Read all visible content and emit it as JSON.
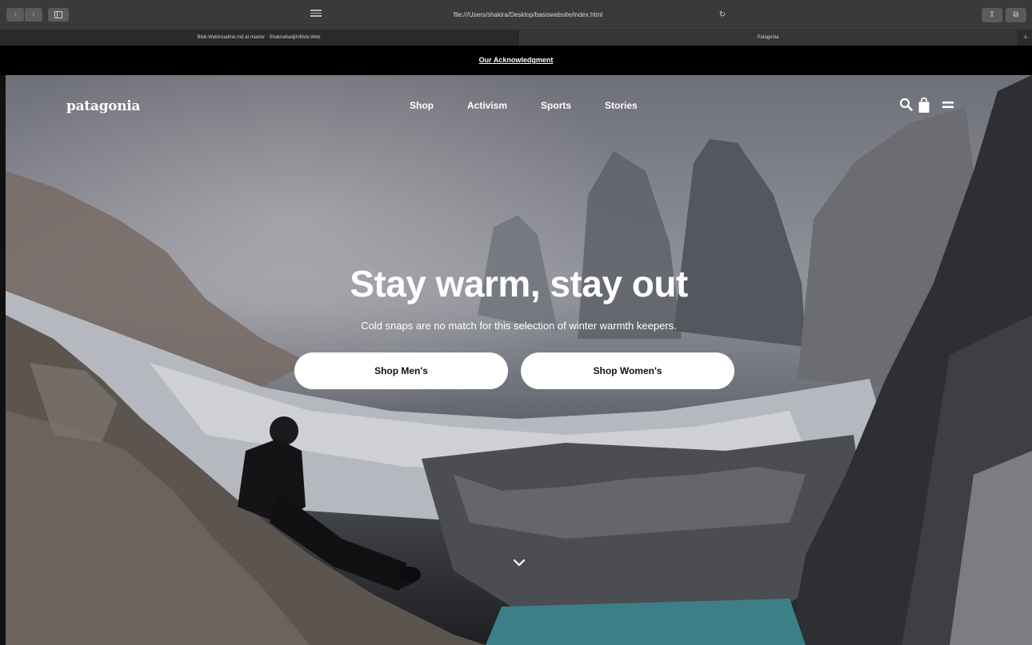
{
  "browser": {
    "back_label": "‹",
    "forward_label": "›",
    "address": "file:///Users/shakira/Desktop/basiswebsite/index.html",
    "reload_label": "↻",
    "share_label": "⇪",
    "tabs_label": "⧉",
    "tabs": [
      {
        "title": "Blok-Web/readme.md at master · Shakirahadjih/Blok-Web",
        "active": false
      },
      {
        "title": "Patagonia",
        "active": true
      }
    ],
    "new_tab_label": "+"
  },
  "acknowledgment": {
    "link_text": "Our Acknowledgment"
  },
  "header": {
    "logo": "patagonia",
    "nav": [
      "Shop",
      "Activism",
      "Sports",
      "Stories"
    ],
    "icons": [
      "search-icon",
      "shopping-bag-icon",
      "menu-icon"
    ]
  },
  "hero": {
    "title": "Stay warm, stay out",
    "subtitle": "Cold snaps are no match for this selection of winter warmth keepers.",
    "buttons": [
      "Shop Men's",
      "Shop Women's"
    ],
    "scroll_icon": "chevron-down-icon"
  },
  "colors": {
    "accent": "#ffffff",
    "topbar": "#000000"
  }
}
